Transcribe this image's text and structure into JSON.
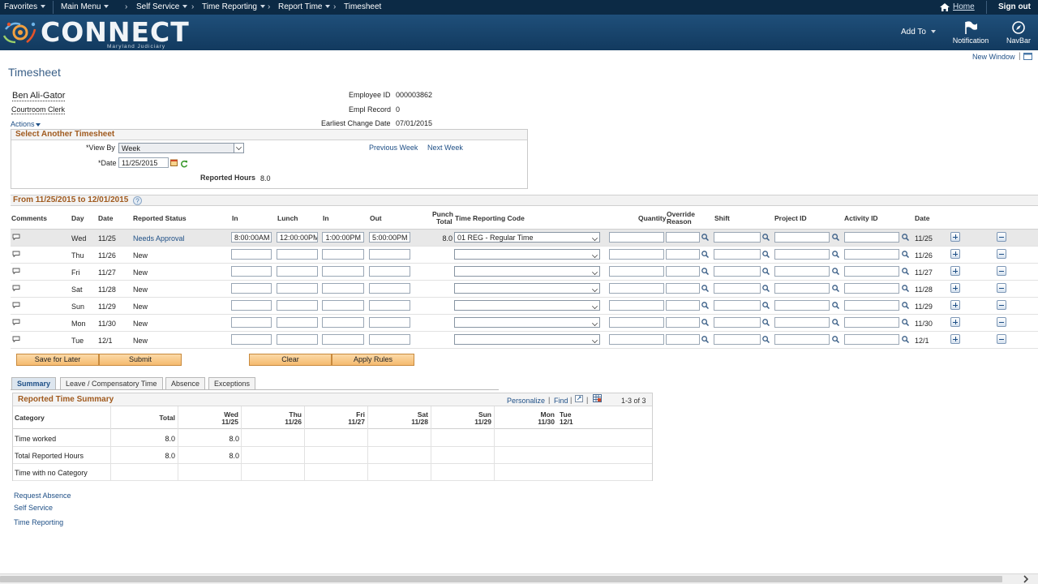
{
  "topbar": {
    "favorites": "Favorites",
    "main_menu": "Main Menu",
    "breadcrumbs": [
      "Self Service",
      "Time Reporting",
      "Report Time",
      "Timesheet"
    ],
    "home": "Home",
    "sign_out": "Sign out"
  },
  "header": {
    "logo": "CONNECT",
    "logo_sub": "Maryland Judiciary",
    "add_to": "Add To",
    "notification": "Notification",
    "navbar": "NavBar"
  },
  "new_window": "New Window",
  "page_title": "Timesheet",
  "employee": {
    "name": "Ben Ali-Gator",
    "job": "Courtroom Clerk",
    "actions": "Actions",
    "employee_id_label": "Employee ID",
    "employee_id": "000003862",
    "empl_record_label": "Empl Record",
    "empl_record": "0",
    "earliest_change_label": "Earliest Change Date",
    "earliest_change": "07/01/2015"
  },
  "select_timesheet": {
    "title": "Select Another Timesheet",
    "view_by_label": "*View By",
    "view_by": "Week",
    "date_label": "*Date",
    "date": "11/25/2015",
    "previous_week": "Previous Week",
    "next_week": "Next Week",
    "reported_hours_label": "Reported Hours",
    "reported_hours": "8.0"
  },
  "grid": {
    "period": "From 11/25/2015 to 12/01/2015",
    "headers": {
      "comments": "Comments",
      "day": "Day",
      "date": "Date",
      "status": "Reported Status",
      "in1": "In",
      "lunch": "Lunch",
      "in2": "In",
      "out": "Out",
      "punch_total_1": "Punch",
      "punch_total_2": "Total",
      "trc": "Time Reporting Code",
      "quantity": "Quantity",
      "override_1": "Override",
      "override_2": "Reason",
      "shift": "Shift",
      "project": "Project ID",
      "activity": "Activity ID",
      "date2": "Date"
    },
    "rows": [
      {
        "day": "Wed",
        "date": "11/25",
        "status": "Needs Approval",
        "in1": "8:00:00AM",
        "lunch": "12:00:00PM",
        "in2": "1:00:00PM",
        "out": "5:00:00PM",
        "total": "8.0",
        "trc": "01 REG - Regular Time",
        "date2": "11/25"
      },
      {
        "day": "Thu",
        "date": "11/26",
        "status": "New",
        "in1": "",
        "lunch": "",
        "in2": "",
        "out": "",
        "total": "",
        "trc": "",
        "date2": "11/26"
      },
      {
        "day": "Fri",
        "date": "11/27",
        "status": "New",
        "in1": "",
        "lunch": "",
        "in2": "",
        "out": "",
        "total": "",
        "trc": "",
        "date2": "11/27"
      },
      {
        "day": "Sat",
        "date": "11/28",
        "status": "New",
        "in1": "",
        "lunch": "",
        "in2": "",
        "out": "",
        "total": "",
        "trc": "",
        "date2": "11/28"
      },
      {
        "day": "Sun",
        "date": "11/29",
        "status": "New",
        "in1": "",
        "lunch": "",
        "in2": "",
        "out": "",
        "total": "",
        "trc": "",
        "date2": "11/29"
      },
      {
        "day": "Mon",
        "date": "11/30",
        "status": "New",
        "in1": "",
        "lunch": "",
        "in2": "",
        "out": "",
        "total": "",
        "trc": "",
        "date2": "11/30"
      },
      {
        "day": "Tue",
        "date": "12/1",
        "status": "New",
        "in1": "",
        "lunch": "",
        "in2": "",
        "out": "",
        "total": "",
        "trc": "",
        "date2": "12/1"
      }
    ]
  },
  "buttons": {
    "save_for_later": "Save for Later",
    "submit": "Submit",
    "clear": "Clear",
    "apply_rules": "Apply Rules"
  },
  "tabs": [
    "Summary",
    "Leave / Compensatory Time",
    "Absence",
    "Exceptions"
  ],
  "summary": {
    "title": "Reported Time Summary",
    "personalize": "Personalize",
    "find": "Find",
    "range": "1-3 of 3",
    "col_category": "Category",
    "col_total": "Total",
    "days": [
      {
        "d": "Wed",
        "dt": "11/25"
      },
      {
        "d": "Thu",
        "dt": "11/26"
      },
      {
        "d": "Fri",
        "dt": "11/27"
      },
      {
        "d": "Sat",
        "dt": "11/28"
      },
      {
        "d": "Sun",
        "dt": "11/29"
      },
      {
        "d": "Mon",
        "dt": "11/30"
      },
      {
        "d": "Tue",
        "dt": "12/1"
      }
    ],
    "rows": [
      {
        "category": "Time worked",
        "total": "8.0",
        "wed": "8.0"
      },
      {
        "category": "Total Reported Hours",
        "total": "8.0",
        "wed": "8.0"
      },
      {
        "category": "Time with no Category",
        "total": "",
        "wed": ""
      }
    ]
  },
  "links": [
    "Request Absence",
    "Self Service",
    "Time Reporting"
  ]
}
